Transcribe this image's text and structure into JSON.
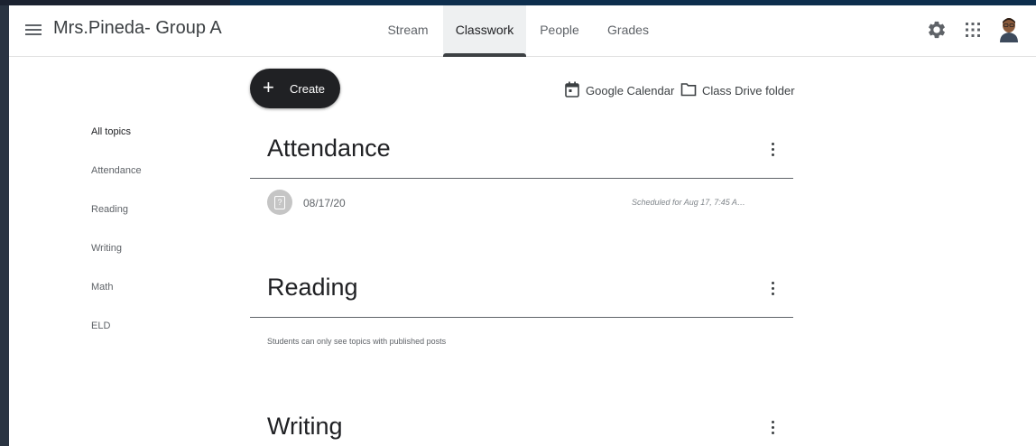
{
  "header": {
    "class_name": "Mrs.Pineda- Group A",
    "tabs": [
      {
        "label": "Stream"
      },
      {
        "label": "Classwork"
      },
      {
        "label": "People"
      },
      {
        "label": "Grades"
      }
    ],
    "active_tab": "Classwork"
  },
  "actions": {
    "create_label": "Create",
    "calendar_label": "Google Calendar",
    "drive_label": "Class Drive folder"
  },
  "topics": {
    "items": [
      {
        "label": "All topics"
      },
      {
        "label": "Attendance"
      },
      {
        "label": "Reading"
      },
      {
        "label": "Writing"
      },
      {
        "label": "Math"
      },
      {
        "label": "ELD"
      }
    ]
  },
  "sections": [
    {
      "title": "Attendance",
      "items": [
        {
          "title": "08/17/20",
          "scheduled": "Scheduled for Aug 17, 7:45 A…"
        }
      ]
    },
    {
      "title": "Reading",
      "note": "Students can only see topics with published posts"
    },
    {
      "title": "Writing"
    }
  ],
  "colors": {
    "create_button": "#202124",
    "active_tab_indicator": "#3c4043",
    "backdrop": "#1f2b3a"
  },
  "icons": {
    "menu": "menu-icon",
    "settings": "gear-icon",
    "apps": "apps-grid-icon",
    "calendar": "calendar-icon",
    "folder": "folder-icon",
    "more": "more-vert-icon",
    "assignment": "question-assignment-icon"
  }
}
